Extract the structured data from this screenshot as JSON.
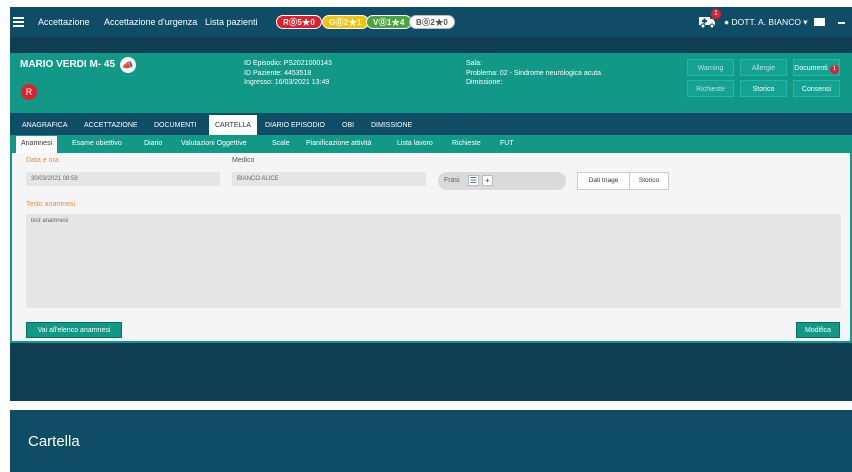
{
  "navbar": {
    "links": [
      "Accettazione",
      "Accettazione d'urgenza",
      "Lista pazienti"
    ],
    "triage_pills": [
      {
        "label": "R⓪5★0",
        "color": "#e0202a"
      },
      {
        "label": "G⓪2★1",
        "color": "#f4c20d"
      },
      {
        "label": "V⓪1★4",
        "color": "#4ca53a"
      },
      {
        "label": "B⓪2★0",
        "color": "#ffffff"
      }
    ],
    "ambulance_badge": "1",
    "user": "DOTT. A. BIANCO ▾"
  },
  "patient": {
    "name": "MARIO VERDI M- 45",
    "code_badge": "R",
    "episode_id": "ID Episodio: PS2021000143",
    "patient_id": "ID Paziente: 4453518",
    "admission": "Ingresso: 16/03/2021 13:49",
    "room": "Sala:",
    "problem": "Problema: 02 - Sindrome neurologica acuta",
    "discharge": "Dimissione:",
    "buttons": {
      "warning": "Warning",
      "allergie": "Allergie",
      "documenti": "Documenti",
      "documenti_badge": "1",
      "richieste": "Richieste",
      "storico": "Storico",
      "consensi": "Consensi"
    }
  },
  "main_tabs": [
    "ANAGRAFICA",
    "ACCETTAZIONE",
    "DOCUMENTI",
    "CARTELLA",
    "DIARIO EPISODIO",
    "OBI",
    "DIMISSIONE"
  ],
  "sub_tabs": [
    "Anamnesi",
    "Esame obiettivo",
    "Diario",
    "Valutazioni Oggettive",
    "Scale",
    "Pianificazione attività",
    "Lista lavoro",
    "Richieste",
    "FUT"
  ],
  "form": {
    "date_label": "Data e ora",
    "date_value": "30/03/2021 08:59",
    "doctor_label": "Medico",
    "doctor_value": "BIANCO ALICE",
    "frasi_label": "Frasi",
    "triage_button": "Dati triage",
    "history_button": "Storico",
    "text_label": "Testo anamnesi",
    "text_value": "test anamnesi",
    "list_button": "Vai all'elenco anamnesi",
    "edit_button": "Modifica"
  },
  "caption": "Cartella",
  "colors": {
    "navy": "#0f4c66",
    "teal": "#129887",
    "accent_orange": "#e8913b"
  }
}
